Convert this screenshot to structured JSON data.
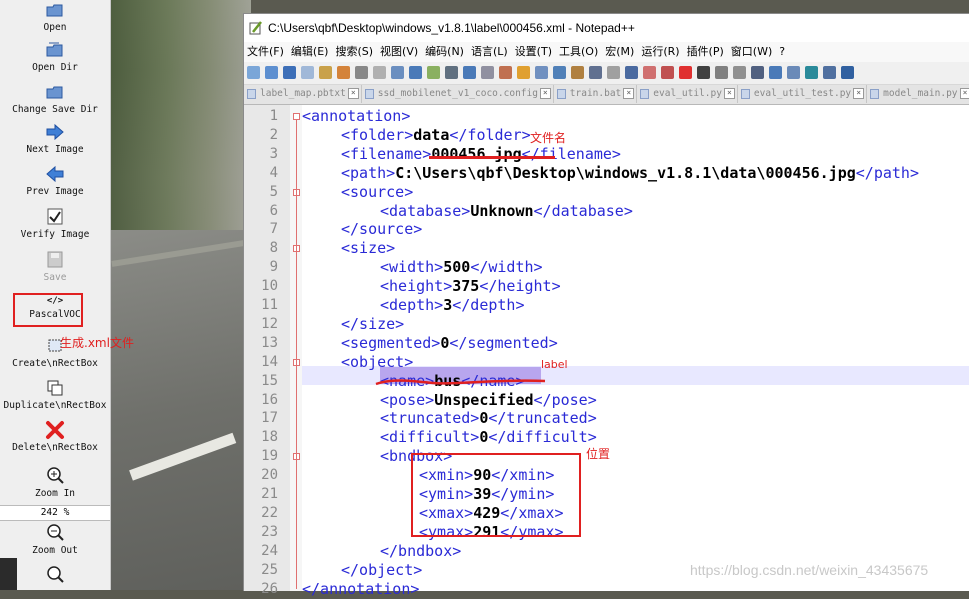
{
  "left_toolbar": {
    "items": [
      {
        "label": "Open",
        "icon": "open-folder-icon"
      },
      {
        "label": "Open Dir",
        "icon": "open-dir-icon"
      },
      {
        "label": "Change Save Dir",
        "icon": "change-save-dir-icon"
      },
      {
        "label": "Next Image",
        "icon": "next-arrow-icon"
      },
      {
        "label": "Prev Image",
        "icon": "prev-arrow-icon"
      },
      {
        "label": "Verify Image",
        "icon": "check-icon"
      },
      {
        "label": "Save",
        "icon": "save-icon"
      },
      {
        "label": "PascalVOC",
        "icon": "code-icon"
      },
      {
        "label": "Create\\nRectBox",
        "icon": "create-rect-icon"
      },
      {
        "label": "Duplicate\\nRectBox",
        "icon": "duplicate-icon"
      },
      {
        "label": "Delete\\nRectBox",
        "icon": "delete-x-icon"
      },
      {
        "label": "Zoom In",
        "icon": "zoom-in-icon"
      },
      {
        "label": "Zoom Out",
        "icon": "zoom-out-icon"
      }
    ],
    "zoom_value": "242 %"
  },
  "notepad": {
    "title": "C:\\Users\\qbf\\Desktop\\windows_v1.8.1\\label\\000456.xml - Notepad++",
    "menu": [
      "文件(F)",
      "编辑(E)",
      "搜索(S)",
      "视图(V)",
      "编码(N)",
      "语言(L)",
      "设置(T)",
      "工具(O)",
      "宏(M)",
      "运行(R)",
      "插件(P)",
      "窗口(W)",
      "?"
    ],
    "tabs": [
      "label_map.pbtxt",
      "ssd_mobilenet_v1_coco.config",
      "train.bat",
      "eval_util.py",
      "eval_util_test.py",
      "model_main.py"
    ],
    "lines": [
      {
        "n": "1",
        "seg": [
          [
            "t",
            "<annotation>"
          ]
        ]
      },
      {
        "n": "2",
        "seg": [
          [
            "t",
            "<folder>"
          ],
          [
            "b",
            "data"
          ],
          [
            "t",
            "</folder>"
          ]
        ]
      },
      {
        "n": "3",
        "seg": [
          [
            "t",
            "<filename>"
          ],
          [
            "b",
            "000456.jpg"
          ],
          [
            "t",
            "</filename>"
          ]
        ]
      },
      {
        "n": "4",
        "seg": [
          [
            "t",
            "<path>"
          ],
          [
            "b",
            "C:\\Users\\qbf\\Desktop\\windows_v1.8.1\\data\\000456.jpg"
          ],
          [
            "t",
            "</path>"
          ]
        ]
      },
      {
        "n": "5",
        "seg": [
          [
            "t",
            "<source>"
          ]
        ]
      },
      {
        "n": "6",
        "seg": [
          [
            "t",
            "<database>"
          ],
          [
            "b",
            "Unknown"
          ],
          [
            "t",
            "</database>"
          ]
        ]
      },
      {
        "n": "7",
        "seg": [
          [
            "t",
            "</source>"
          ]
        ]
      },
      {
        "n": "8",
        "seg": [
          [
            "t",
            "<size>"
          ]
        ]
      },
      {
        "n": "9",
        "seg": [
          [
            "t",
            "<width>"
          ],
          [
            "b",
            "500"
          ],
          [
            "t",
            "</width>"
          ]
        ]
      },
      {
        "n": "10",
        "seg": [
          [
            "t",
            "<height>"
          ],
          [
            "b",
            "375"
          ],
          [
            "t",
            "</height>"
          ]
        ]
      },
      {
        "n": "11",
        "seg": [
          [
            "t",
            "<depth>"
          ],
          [
            "b",
            "3"
          ],
          [
            "t",
            "</depth>"
          ]
        ]
      },
      {
        "n": "12",
        "seg": [
          [
            "t",
            "</size>"
          ]
        ]
      },
      {
        "n": "13",
        "seg": [
          [
            "t",
            "<segmented>"
          ],
          [
            "b",
            "0"
          ],
          [
            "t",
            "</segmented>"
          ]
        ]
      },
      {
        "n": "14",
        "seg": [
          [
            "t",
            "<object>"
          ]
        ]
      },
      {
        "n": "15",
        "seg": [
          [
            "t",
            "<name>"
          ],
          [
            "b",
            "bus"
          ],
          [
            "t",
            "</name>"
          ]
        ]
      },
      {
        "n": "16",
        "seg": [
          [
            "t",
            "<pose>"
          ],
          [
            "b",
            "Unspecified"
          ],
          [
            "t",
            "</pose>"
          ]
        ]
      },
      {
        "n": "17",
        "seg": [
          [
            "t",
            "<truncated>"
          ],
          [
            "b",
            "0"
          ],
          [
            "t",
            "</truncated>"
          ]
        ]
      },
      {
        "n": "18",
        "seg": [
          [
            "t",
            "<difficult>"
          ],
          [
            "b",
            "0"
          ],
          [
            "t",
            "</difficult>"
          ]
        ]
      },
      {
        "n": "19",
        "seg": [
          [
            "t",
            "<bndbox>"
          ]
        ]
      },
      {
        "n": "20",
        "seg": [
          [
            "t",
            "<xmin>"
          ],
          [
            "b",
            "90"
          ],
          [
            "t",
            "</xmin>"
          ]
        ]
      },
      {
        "n": "21",
        "seg": [
          [
            "t",
            "<ymin>"
          ],
          [
            "b",
            "39"
          ],
          [
            "t",
            "</ymin>"
          ]
        ]
      },
      {
        "n": "22",
        "seg": [
          [
            "t",
            "<xmax>"
          ],
          [
            "b",
            "429"
          ],
          [
            "t",
            "</xmax>"
          ]
        ]
      },
      {
        "n": "23",
        "seg": [
          [
            "t",
            "<ymax>"
          ],
          [
            "b",
            "291"
          ],
          [
            "t",
            "</ymax>"
          ]
        ]
      },
      {
        "n": "24",
        "seg": [
          [
            "t",
            "</bndbox>"
          ]
        ]
      },
      {
        "n": "25",
        "seg": [
          [
            "t",
            "</object>"
          ]
        ]
      },
      {
        "n": "26",
        "seg": [
          [
            "t",
            "</annotation>"
          ]
        ]
      }
    ]
  },
  "annotations": {
    "filename_note": "文件名",
    "generate_note": "生成.xml文件",
    "label_note": "label",
    "position_note": "位置"
  },
  "watermark": "https://blog.csdn.net/weixin_43435675",
  "colors": {
    "tag": "#2a2ad6",
    "annotation_red": "#e02020",
    "selection": "#b8a6ee"
  }
}
